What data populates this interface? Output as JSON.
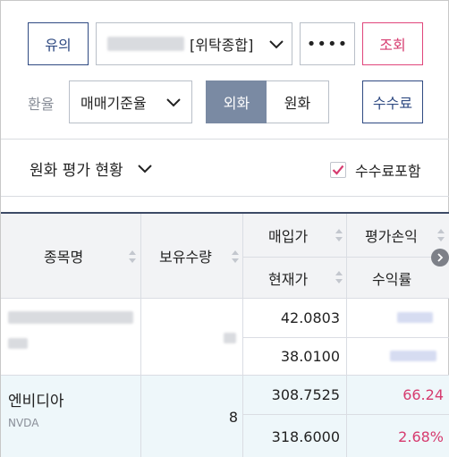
{
  "toolbar": {
    "notice_label": "유의",
    "account_suffix": "[위탁종합]",
    "password_mask": "••••",
    "inquiry_label": "조회"
  },
  "exchange": {
    "label": "환율",
    "rate_type": "매매기준율",
    "toggle_foreign": "외화",
    "toggle_won": "원화",
    "fee_button": "수수료"
  },
  "section": {
    "title": "원화 평가 현황",
    "include_fee_label": "수수료포함",
    "include_fee_checked": true
  },
  "table": {
    "headers": {
      "name": "종목명",
      "qty": "보유수량",
      "buy_price": "매입가",
      "current_price": "현재가",
      "pnl": "평가손익",
      "return_rate": "수익률"
    },
    "rows": [
      {
        "name": "",
        "ticker": "",
        "qty": "",
        "buy_price": "42.0803",
        "current_price": "38.0100",
        "pnl": "",
        "return_rate": ""
      },
      {
        "name": "엔비디아",
        "ticker": "NVDA",
        "qty": "8",
        "buy_price": "308.7525",
        "current_price": "318.6000",
        "pnl": "66.24",
        "return_rate": "2.68%"
      }
    ]
  },
  "colors": {
    "navy": "#2f4a82",
    "pink": "#d63b6f",
    "toggle_active": "#7a8aa3",
    "row_highlight": "#eef7fa"
  }
}
